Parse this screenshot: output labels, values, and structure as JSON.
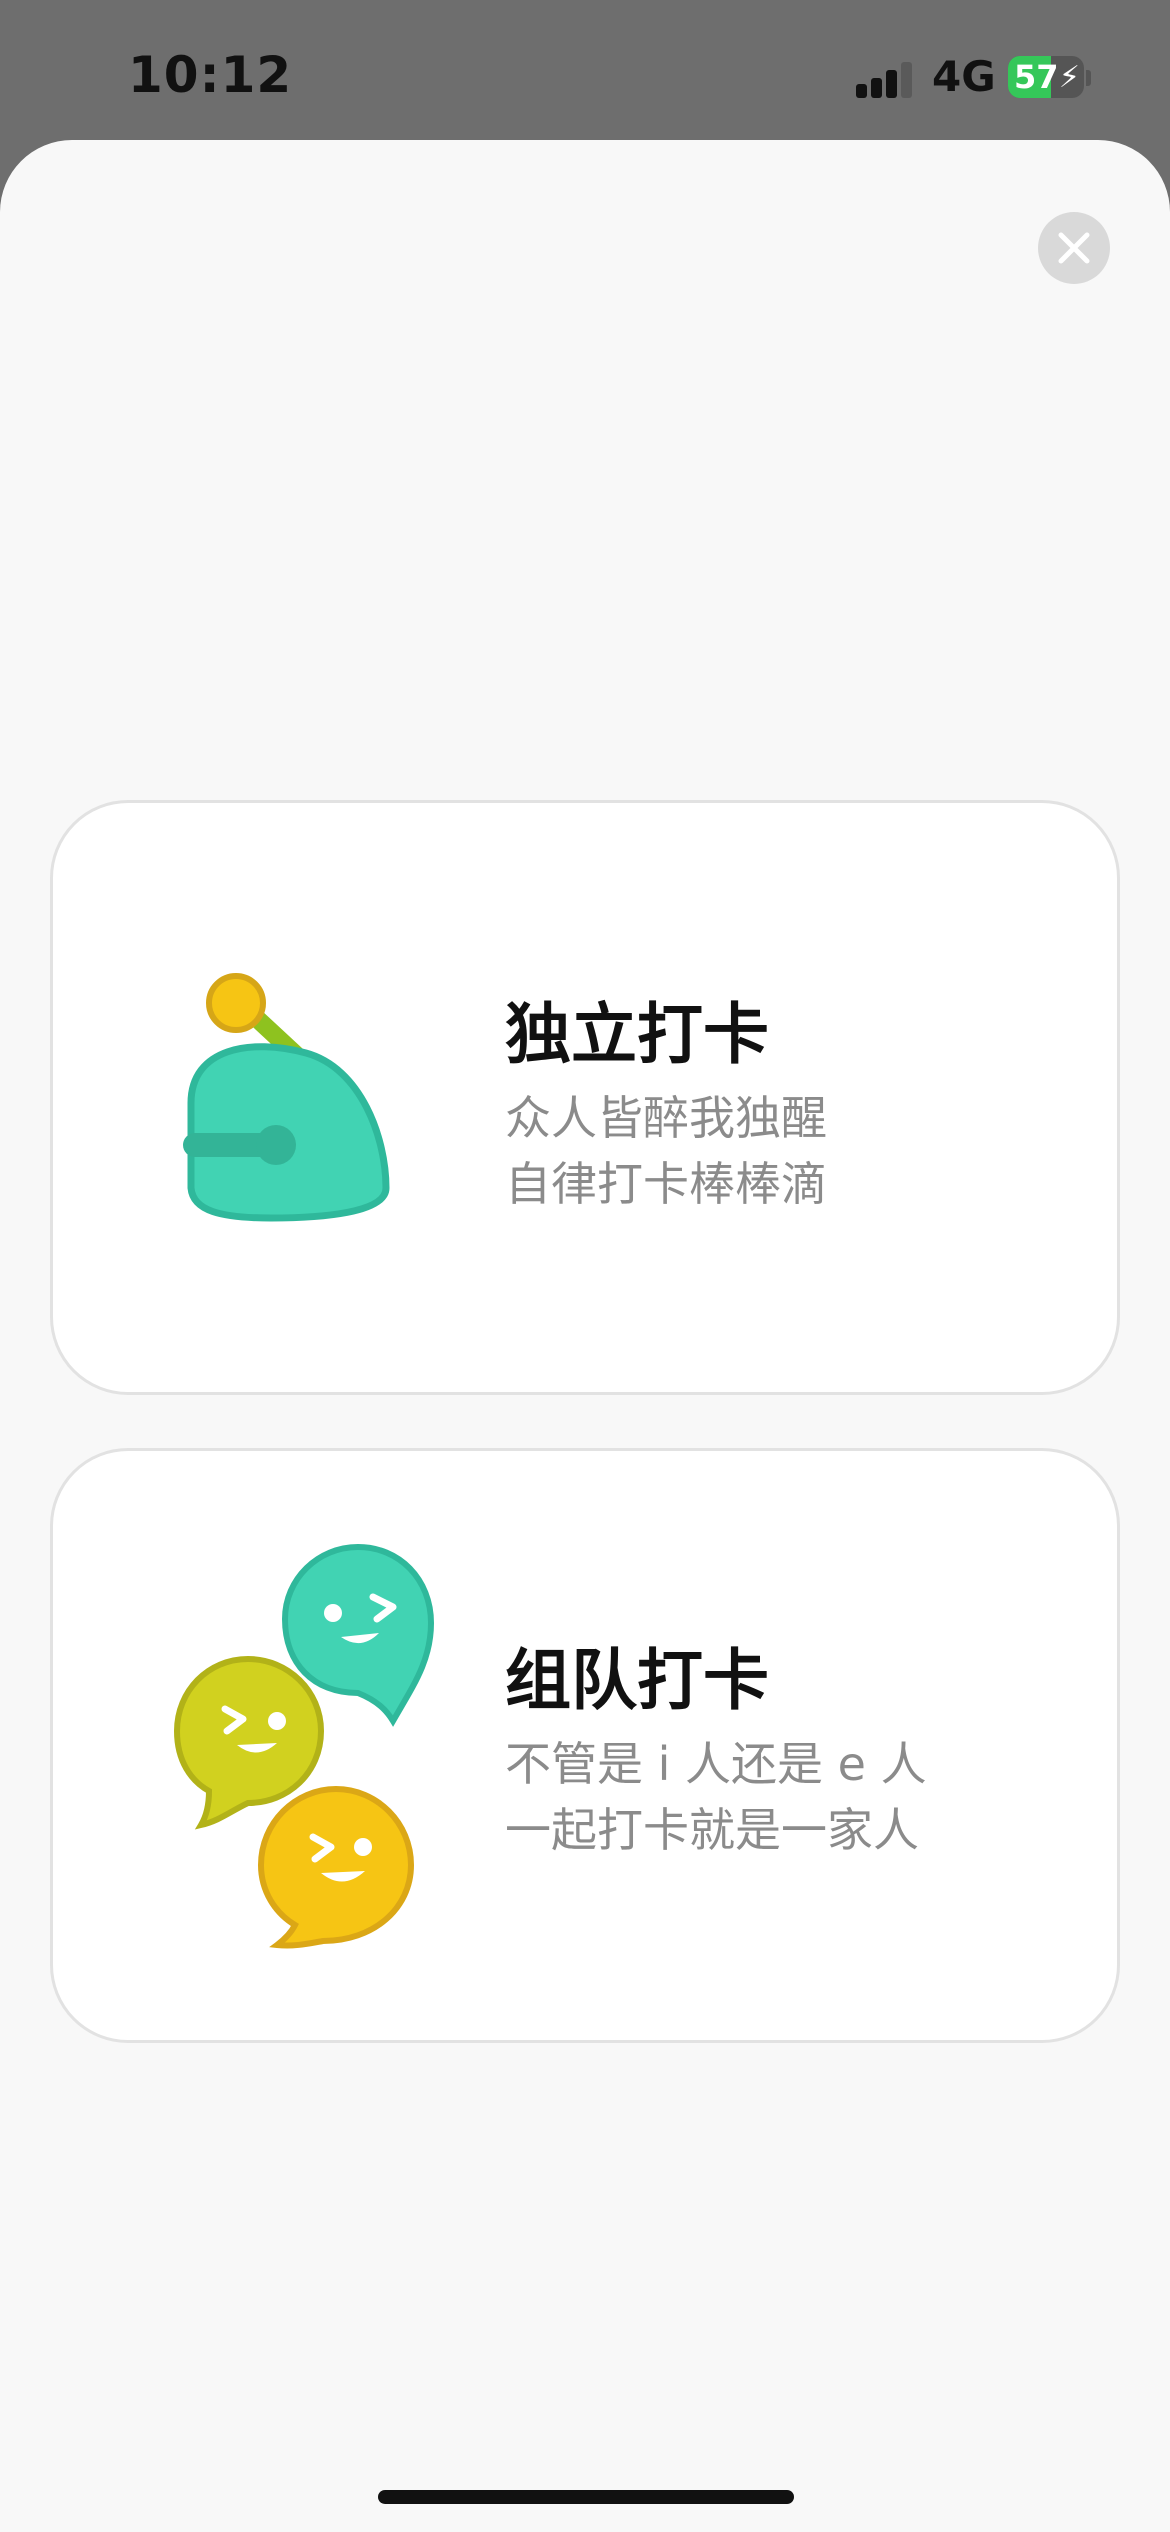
{
  "status_bar": {
    "time": "10:12",
    "network": "4G",
    "battery_percent": "57",
    "battery_level": 0.57,
    "battery_color": "#35c759"
  },
  "close_button": {
    "icon": "close-icon"
  },
  "cards": [
    {
      "title": "独立打卡",
      "desc_line1": "众人皆醉我独醒",
      "desc_line2": "自律打卡棒棒滴",
      "icon": "solo-bell-icon"
    },
    {
      "title": "组队打卡",
      "desc_line1": "不管是 i 人还是 e 人",
      "desc_line2": "一起打卡就是一家人",
      "icon": "team-bubbles-icon"
    }
  ],
  "colors": {
    "teal": "#41d3b3",
    "lime": "#d1d11f",
    "yellow": "#f6c514"
  }
}
